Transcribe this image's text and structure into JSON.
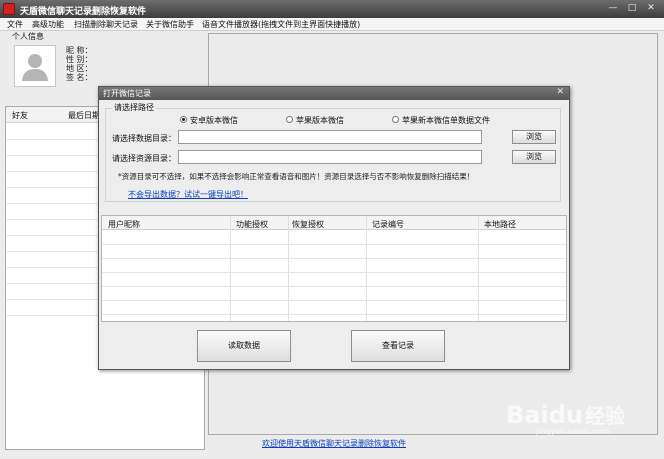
{
  "app": {
    "title": "天盾微信聊天记录删除恢复软件",
    "colors": {
      "accent": "#d32020",
      "link": "#0a3fc4"
    }
  },
  "menu": [
    "文件",
    "高级功能",
    "扫描删除聊天记录",
    "关于微信助手",
    "语音文件播放器(拖拽文件到主界面快捷播放)"
  ],
  "profile": {
    "group_title": "个人信息",
    "fields": [
      "昵 称：",
      "性 别：",
      "地 区：",
      "签 名："
    ]
  },
  "friends": {
    "col_friend": "好友",
    "col_last_date": "最后日期"
  },
  "dialog": {
    "title": "打开微信记录",
    "close_icon": "close-icon",
    "path_group_title": "请选择路径",
    "radios": [
      {
        "label": "安卓版本微信",
        "checked": true
      },
      {
        "label": "苹果版本微信",
        "checked": false
      },
      {
        "label": "苹果新本微信单数据文件",
        "checked": false
      }
    ],
    "data_dir_label": "请选择数据目录：",
    "data_dir_value": "",
    "res_dir_label": "请选择资源目录：",
    "res_dir_value": "",
    "browse_label": "浏览",
    "note": "*资源目录可不选择，如果不选择会影响正常查看语音和图片！资源目录选择与否不影响恢复删除扫描结果！",
    "help_link": "不会导出数据？试试一键导出吧！",
    "table_headers": [
      "用户昵称",
      "功能授权",
      "恢复授权",
      "记录编号",
      "本地路径"
    ],
    "read_button": "读取数据",
    "view_button": "查看记录"
  },
  "bottom_link": "欢迎使用天盾微信聊天记录删除恢复软件",
  "watermark": {
    "brand": "Bai",
    "paw": "du",
    "suffix": "经验",
    "url": "jingyan.baidu.com"
  }
}
